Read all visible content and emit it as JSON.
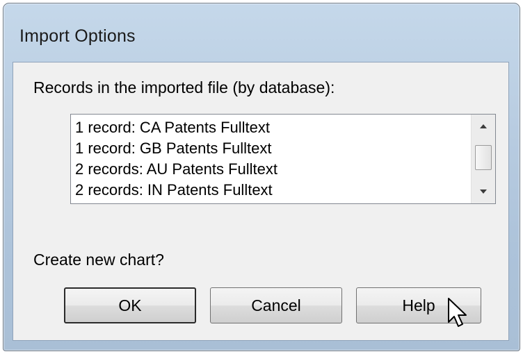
{
  "window": {
    "title": "Import Options"
  },
  "records": {
    "label": "Records in the imported file (by database):",
    "items": [
      "1 record: CA Patents Fulltext",
      "1 record: GB Patents Fulltext",
      "2 records: AU Patents Fulltext",
      "2 records: IN Patents Fulltext"
    ]
  },
  "scrollbar": {
    "up_icon": "scroll-up-arrow-icon",
    "down_icon": "scroll-down-arrow-icon"
  },
  "prompt": {
    "question": "Create new chart?"
  },
  "buttons": {
    "ok_label": "OK",
    "cancel_label": "Cancel",
    "help_label": "Help"
  }
}
